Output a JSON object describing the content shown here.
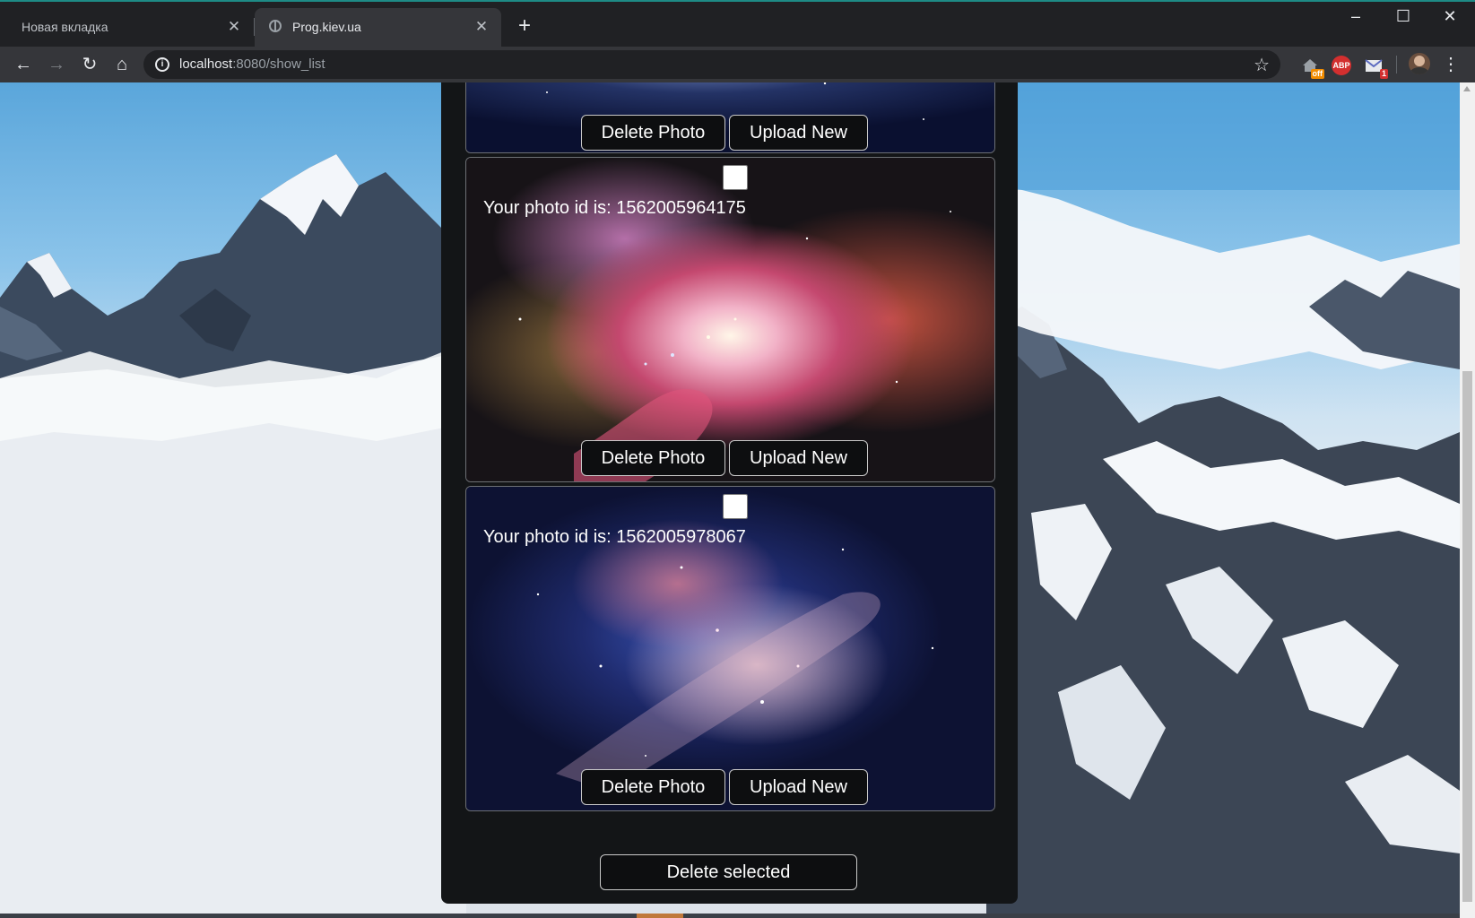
{
  "browser": {
    "tabs": [
      {
        "title": "Новая вкладка",
        "active": false
      },
      {
        "title": "Prog.kiev.ua",
        "active": true
      }
    ],
    "new_tab_label": "+",
    "address": {
      "host": "localhost",
      "path": ":8080/show_list"
    },
    "extensions": [
      {
        "name": "home-off-extension",
        "badge": "off"
      },
      {
        "name": "adblock-plus-extension",
        "label": "ABP"
      },
      {
        "name": "mail-checker-extension",
        "badge": "1"
      }
    ]
  },
  "page": {
    "photos": [
      {
        "id_text": "",
        "checked": false,
        "delete_label": "Delete Photo",
        "upload_label": "Upload New"
      },
      {
        "id_text": "Your photo id is: 1562005964175",
        "checked": false,
        "delete_label": "Delete Photo",
        "upload_label": "Upload New"
      },
      {
        "id_text": "Your photo id is: 1562005978067",
        "checked": false,
        "delete_label": "Delete Photo",
        "upload_label": "Upload New"
      }
    ],
    "delete_selected_label": "Delete selected"
  },
  "colors": {
    "chrome_dark": "#202124",
    "chrome_toolbar": "#35363a",
    "panel_bg": "#131517",
    "card_border": "#6d7075",
    "button_bg": "#0d0e10"
  }
}
